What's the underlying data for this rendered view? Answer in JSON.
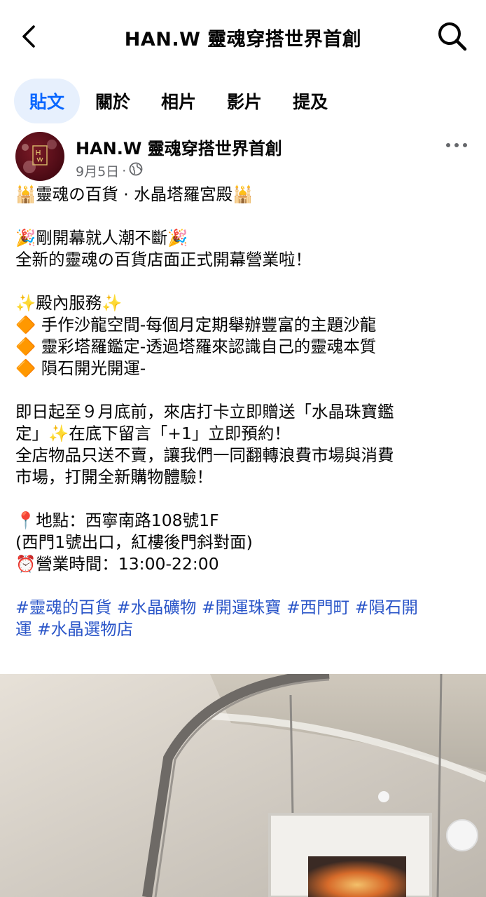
{
  "header": {
    "title": "HAN.W 靈魂穿搭世界首創"
  },
  "tabs": [
    {
      "label": "貼文",
      "active": true
    },
    {
      "label": "關於",
      "active": false
    },
    {
      "label": "相片",
      "active": false
    },
    {
      "label": "影片",
      "active": false
    },
    {
      "label": "提及",
      "active": false
    }
  ],
  "post": {
    "author": "HAN.W 靈魂穿搭世界首創",
    "date": "9月5日",
    "separator": "·",
    "audience_icon": "globe-icon",
    "lines": {
      "l1": "🕌靈魂の百貨 · 水晶塔羅宮殿🕌",
      "l2": "🎉剛開幕就人潮不斷🎉",
      "l3": "全新的靈魂の百貨店面正式開幕營業啦！",
      "l4": "✨殿內服務✨",
      "l5": "🔶 手作沙龍空間-每個月定期舉辦豐富的主題沙龍",
      "l6": "🔶 靈彩塔羅鑑定-透過塔羅來認識自己的靈魂本質",
      "l7": "🔶 隕石開光開運-",
      "l8": "即日起至９月底前，來店打卡立即贈送「水晶珠寶鑑",
      "l9": "定」✨在底下留言「+1」立即預約！",
      "l10": "全店物品只送不賣，讓我們一同翻轉浪費市場與消費",
      "l11": "市場，打開全新購物體驗！",
      "l12": "📍地點：西寧南路108號1F",
      "l13": "(西門1號出口，紅樓後門斜對面)",
      "l14": "⏰營業時間：13:00-22:00",
      "h1": "#靈魂的百貨 #水晶礦物 #開運珠寶 #西門町 #隕石開",
      "h2": "運 #水晶選物店"
    }
  },
  "colors": {
    "accent": "#0866ff",
    "active_tab_bg": "#e7f0fd",
    "hashtag": "#2a55c8",
    "secondary_text": "#65676b"
  }
}
